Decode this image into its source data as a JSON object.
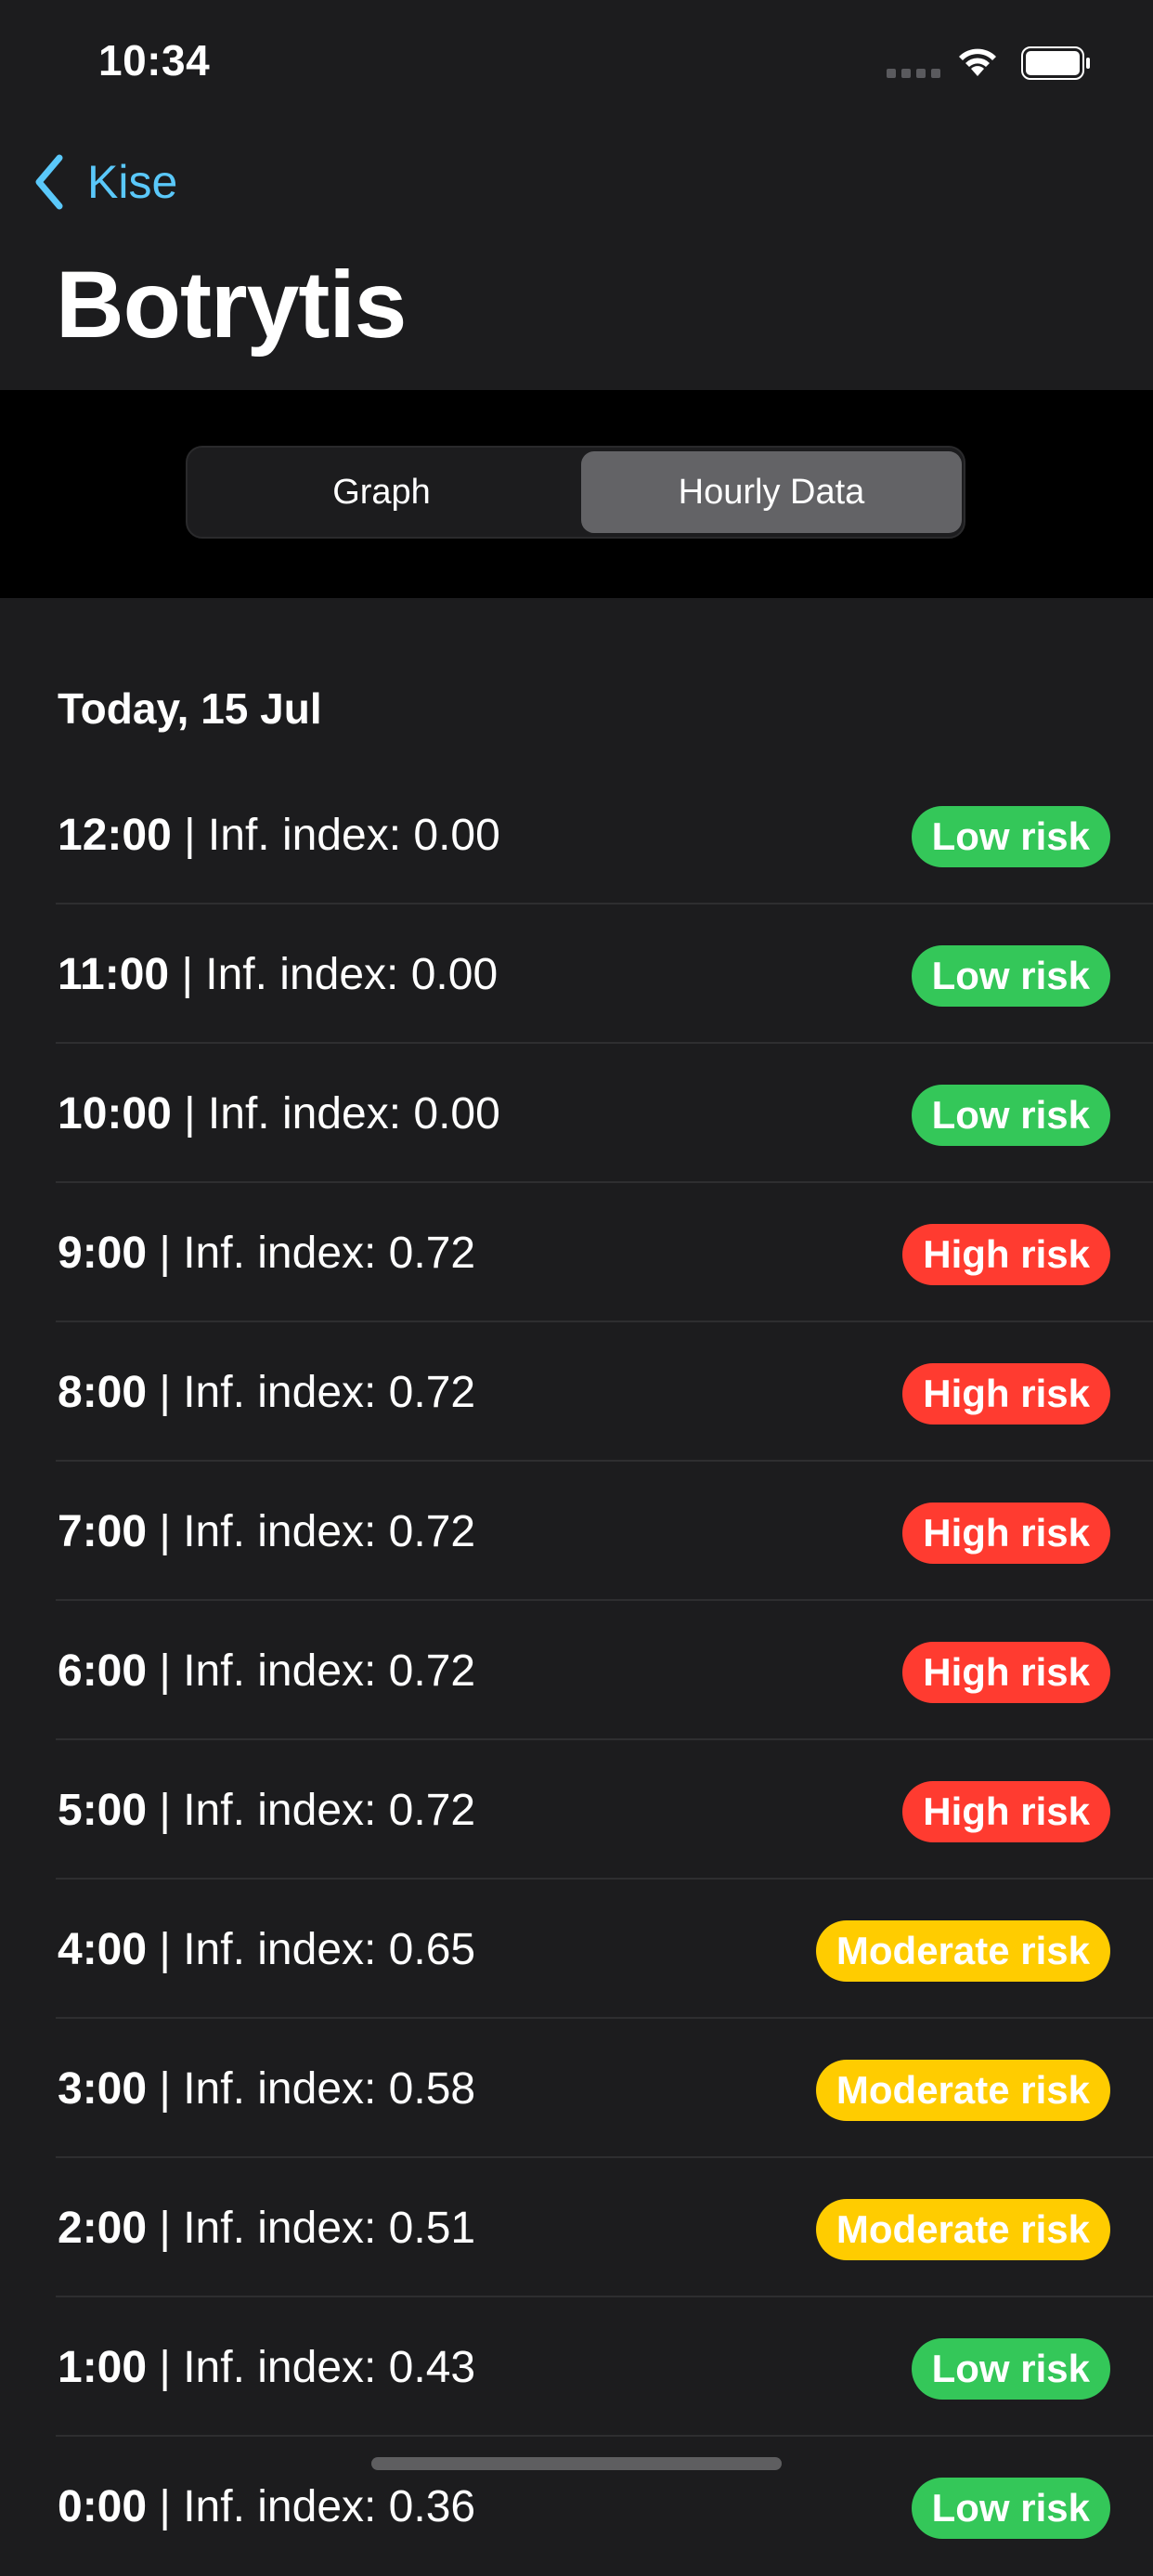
{
  "status_bar": {
    "time": "10:34"
  },
  "nav": {
    "back_label": "Kise",
    "title": "Botrytis"
  },
  "segments": {
    "graph": "Graph",
    "hourly": "Hourly Data",
    "selected": "Hourly Data"
  },
  "section": {
    "title": "Today, 15 Jul"
  },
  "rows": [
    {
      "hour": "12:00",
      "text": " | Inf. index: 0.00",
      "risk": "Low risk"
    },
    {
      "hour": "11:00",
      "text": " | Inf. index: 0.00",
      "risk": "Low risk"
    },
    {
      "hour": "10:00",
      "text": " | Inf. index: 0.00",
      "risk": "Low risk"
    },
    {
      "hour": "9:00",
      "text": " | Inf. index: 0.72",
      "risk": "High risk"
    },
    {
      "hour": "8:00",
      "text": " | Inf. index: 0.72",
      "risk": "High risk"
    },
    {
      "hour": "7:00",
      "text": " | Inf. index: 0.72",
      "risk": "High risk"
    },
    {
      "hour": "6:00",
      "text": " | Inf. index: 0.72",
      "risk": "High risk"
    },
    {
      "hour": "5:00",
      "text": " | Inf. index: 0.72",
      "risk": "High risk"
    },
    {
      "hour": "4:00",
      "text": " | Inf. index: 0.65",
      "risk": "Moderate risk"
    },
    {
      "hour": "3:00",
      "text": " | Inf. index: 0.58",
      "risk": "Moderate risk"
    },
    {
      "hour": "2:00",
      "text": " | Inf. index: 0.51",
      "risk": "Moderate risk"
    },
    {
      "hour": "1:00",
      "text": " | Inf. index: 0.43",
      "risk": "Low risk"
    },
    {
      "hour": "0:00",
      "text": " | Inf. index: 0.36",
      "risk": "Low risk"
    }
  ],
  "colors": {
    "low": "#34c759",
    "high": "#ff3b30",
    "moderate": "#ffcc00",
    "accent": "#5ac8fa"
  }
}
